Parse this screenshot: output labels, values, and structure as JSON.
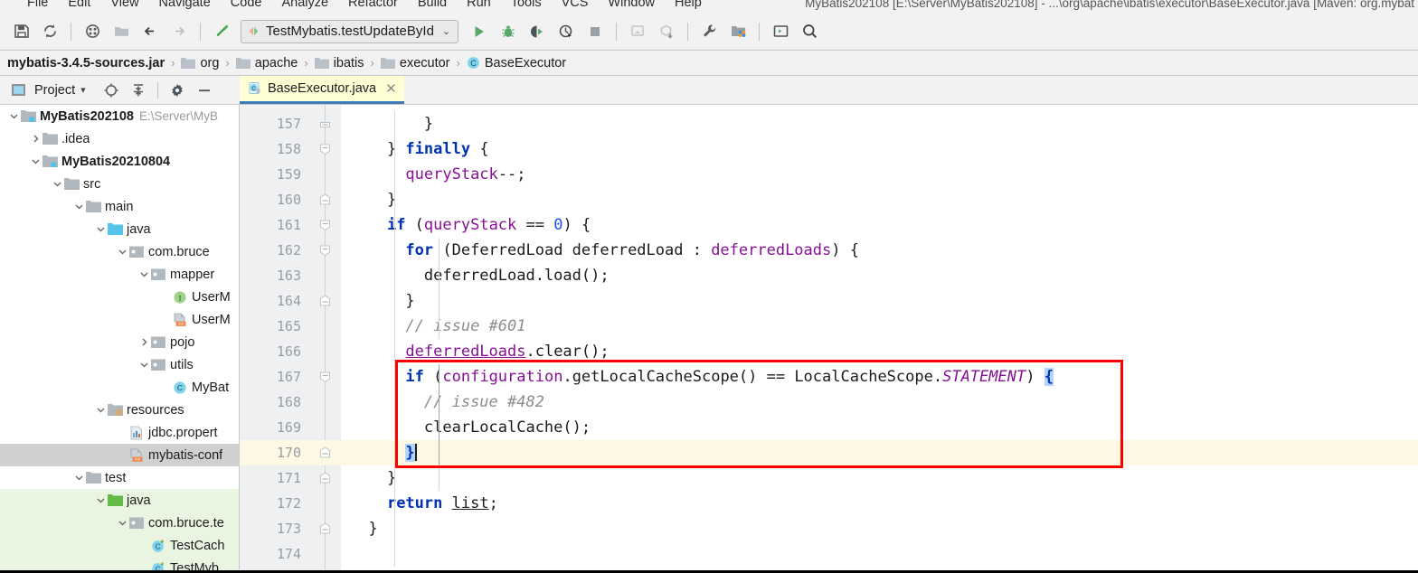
{
  "window": {
    "title": "MyBatis202108 [E:\\Server\\MyBatis202108] - ...\\org\\apache\\ibatis\\executor\\BaseExecutor.java [Maven: org.mybat"
  },
  "menubar": {
    "items": [
      "File",
      "Edit",
      "View",
      "Navigate",
      "Code",
      "Analyze",
      "Refactor",
      "Build",
      "Run",
      "Tools",
      "VCS",
      "Window",
      "Help"
    ]
  },
  "toolbar": {
    "icons_left": [
      "save-all-icon",
      "sync-icon",
      "settings-sync-icon",
      "open-folder-icon",
      "back-arrow-icon",
      "forward-arrow-icon",
      "build-hammer-icon"
    ],
    "run_config": {
      "label": "TestMybatis.testUpdateById",
      "chevron": "⌄"
    },
    "icons_right": [
      "run-icon",
      "debug-icon",
      "run-with-coverage-icon",
      "profile-icon",
      "stop-icon",
      "update-app-icon",
      "get-dependencies-icon",
      "wrench-icon",
      "project-structure-icon",
      "terminal-icon",
      "search-everywhere-icon"
    ]
  },
  "breadcrumb": {
    "root": "mybatis-3.4.5-sources.jar",
    "separator": "›",
    "segments": [
      {
        "label": "org",
        "icon": "folder-icon"
      },
      {
        "label": "apache",
        "icon": "folder-icon"
      },
      {
        "label": "ibatis",
        "icon": "folder-icon"
      },
      {
        "label": "executor",
        "icon": "folder-icon"
      },
      {
        "label": "BaseExecutor",
        "icon": "class-icon"
      }
    ]
  },
  "project_panel": {
    "title": "Project",
    "dropdown_chevron": "▾",
    "icons": [
      "locate-icon",
      "collapse-all-icon",
      "gear-icon",
      "hide-icon"
    ]
  },
  "editor_tab": {
    "label": "BaseExecutor.java",
    "icon": "java-class-file-icon",
    "close": "✕"
  },
  "tree": {
    "items": [
      {
        "label": "MyBatis202108",
        "path": "E:\\Server\\MyB",
        "depth": 0,
        "twist": "down",
        "icon": "module-folder-icon",
        "bold": true,
        "state": "normal"
      },
      {
        "label": ".idea",
        "path": "",
        "depth": 1,
        "twist": "right",
        "icon": "folder-icon",
        "bold": false,
        "state": "normal"
      },
      {
        "label": "MyBatis20210804",
        "path": "",
        "depth": 1,
        "twist": "down",
        "icon": "module-folder-icon",
        "bold": true,
        "state": "normal"
      },
      {
        "label": "src",
        "path": "",
        "depth": 2,
        "twist": "down",
        "icon": "folder-icon",
        "bold": false,
        "state": "normal"
      },
      {
        "label": "main",
        "path": "",
        "depth": 3,
        "twist": "down",
        "icon": "folder-icon",
        "bold": false,
        "state": "normal"
      },
      {
        "label": "java",
        "path": "",
        "depth": 4,
        "twist": "down",
        "icon": "source-root-icon",
        "bold": false,
        "state": "normal"
      },
      {
        "label": "com.bruce",
        "path": "",
        "depth": 5,
        "twist": "down",
        "icon": "package-icon",
        "bold": false,
        "state": "normal"
      },
      {
        "label": "mapper",
        "path": "",
        "depth": 6,
        "twist": "down",
        "icon": "package-icon",
        "bold": false,
        "state": "normal"
      },
      {
        "label": "UserM",
        "path": "",
        "depth": 7,
        "twist": "none",
        "icon": "interface-icon",
        "bold": false,
        "state": "normal"
      },
      {
        "label": "UserM",
        "path": "",
        "depth": 7,
        "twist": "none",
        "icon": "xml-file-icon",
        "bold": false,
        "state": "normal"
      },
      {
        "label": "pojo",
        "path": "",
        "depth": 6,
        "twist": "right",
        "icon": "package-icon",
        "bold": false,
        "state": "normal"
      },
      {
        "label": "utils",
        "path": "",
        "depth": 6,
        "twist": "down",
        "icon": "package-icon",
        "bold": false,
        "state": "normal"
      },
      {
        "label": "MyBat",
        "path": "",
        "depth": 7,
        "twist": "none",
        "icon": "class-icon",
        "bold": false,
        "state": "normal"
      },
      {
        "label": "resources",
        "path": "",
        "depth": 4,
        "twist": "down",
        "icon": "resource-root-icon",
        "bold": false,
        "state": "normal"
      },
      {
        "label": "jdbc.propert",
        "path": "",
        "depth": 5,
        "twist": "none",
        "icon": "properties-file-icon",
        "bold": false,
        "state": "normal"
      },
      {
        "label": "mybatis-conf",
        "path": "",
        "depth": 5,
        "twist": "none",
        "icon": "xml-file-icon",
        "bold": false,
        "state": "selected"
      },
      {
        "label": "test",
        "path": "",
        "depth": 3,
        "twist": "down",
        "icon": "folder-icon",
        "bold": false,
        "state": "normal"
      },
      {
        "label": "java",
        "path": "",
        "depth": 4,
        "twist": "down",
        "icon": "test-source-root-icon",
        "bold": false,
        "state": "green"
      },
      {
        "label": "com.bruce.te",
        "path": "",
        "depth": 5,
        "twist": "down",
        "icon": "package-icon",
        "bold": false,
        "state": "green"
      },
      {
        "label": "TestCach",
        "path": "",
        "depth": 6,
        "twist": "none",
        "icon": "test-class-icon",
        "bold": false,
        "state": "green"
      },
      {
        "label": "TestMyb",
        "path": "",
        "depth": 6,
        "twist": "none",
        "icon": "test-class-icon",
        "bold": false,
        "state": "green"
      }
    ]
  },
  "editor": {
    "first_line_number": 157,
    "lines": [
      {
        "n": 157,
        "fold": "collapse-top",
        "indent_guides": [],
        "highlight": false,
        "tokens": [
          {
            "t": "        }",
            "c": "pl"
          }
        ]
      },
      {
        "n": 158,
        "fold": "collapse-mid",
        "indent_guides": [],
        "highlight": false,
        "tokens": [
          {
            "t": "    } ",
            "c": "pl"
          },
          {
            "t": "finally",
            "c": "k"
          },
          {
            "t": " {",
            "c": "pl"
          }
        ]
      },
      {
        "n": 159,
        "fold": "none",
        "indent_guides": [],
        "highlight": false,
        "tokens": [
          {
            "t": "      ",
            "c": "pl"
          },
          {
            "t": "queryStack",
            "c": "fld"
          },
          {
            "t": "--;",
            "c": "pl"
          }
        ]
      },
      {
        "n": 160,
        "fold": "collapse-end",
        "indent_guides": [],
        "highlight": false,
        "tokens": [
          {
            "t": "    }",
            "c": "pl"
          }
        ]
      },
      {
        "n": 161,
        "fold": "collapse-mid",
        "indent_guides": [],
        "highlight": false,
        "tokens": [
          {
            "t": "    ",
            "c": "pl"
          },
          {
            "t": "if",
            "c": "k"
          },
          {
            "t": " (",
            "c": "pl"
          },
          {
            "t": "queryStack",
            "c": "fld"
          },
          {
            "t": " == ",
            "c": "pl"
          },
          {
            "t": "0",
            "c": "num"
          },
          {
            "t": ") {",
            "c": "pl"
          }
        ]
      },
      {
        "n": 162,
        "fold": "collapse-mid",
        "indent_guides": [],
        "highlight": false,
        "tokens": [
          {
            "t": "      ",
            "c": "pl"
          },
          {
            "t": "for",
            "c": "k"
          },
          {
            "t": " (DeferredLoad deferredLoad : ",
            "c": "pl"
          },
          {
            "t": "deferredLoads",
            "c": "fld"
          },
          {
            "t": ") {",
            "c": "pl"
          }
        ]
      },
      {
        "n": 163,
        "fold": "none",
        "indent_guides": [],
        "highlight": false,
        "tokens": [
          {
            "t": "        deferredLoad.load();",
            "c": "pl"
          }
        ]
      },
      {
        "n": 164,
        "fold": "collapse-end",
        "indent_guides": [],
        "highlight": false,
        "tokens": [
          {
            "t": "      }",
            "c": "pl"
          }
        ]
      },
      {
        "n": 165,
        "fold": "none",
        "indent_guides": [],
        "highlight": false,
        "tokens": [
          {
            "t": "      ",
            "c": "pl"
          },
          {
            "t": "// issue #601",
            "c": "cmt"
          }
        ]
      },
      {
        "n": 166,
        "fold": "none",
        "indent_guides": [],
        "highlight": false,
        "tokens": [
          {
            "t": "      ",
            "c": "pl"
          },
          {
            "t": "deferredLoads",
            "c": "fld und"
          },
          {
            "t": ".clear();",
            "c": "pl"
          }
        ]
      },
      {
        "n": 167,
        "fold": "collapse-mid",
        "indent_guides": [],
        "highlight": false,
        "tokens": [
          {
            "t": "      ",
            "c": "pl"
          },
          {
            "t": "if",
            "c": "k"
          },
          {
            "t": " (",
            "c": "pl"
          },
          {
            "t": "configuration",
            "c": "fld"
          },
          {
            "t": ".getLocalCacheScope() == LocalCacheScope.",
            "c": "pl"
          },
          {
            "t": "STATEMENT",
            "c": "sta"
          },
          {
            "t": ") ",
            "c": "pl"
          },
          {
            "t": "{",
            "c": "k selbr"
          }
        ]
      },
      {
        "n": 168,
        "fold": "none",
        "indent_guides": [],
        "highlight": false,
        "tokens": [
          {
            "t": "        ",
            "c": "pl"
          },
          {
            "t": "// issue #482",
            "c": "cmt"
          }
        ]
      },
      {
        "n": 169,
        "fold": "none",
        "indent_guides": [],
        "highlight": false,
        "tokens": [
          {
            "t": "        clearLocalCache();",
            "c": "pl"
          }
        ]
      },
      {
        "n": 170,
        "fold": "collapse-end",
        "indent_guides": [],
        "highlight": true,
        "tokens": [
          {
            "t": "      ",
            "c": "pl"
          },
          {
            "t": "}",
            "c": "k selbr"
          }
        ],
        "caret": true
      },
      {
        "n": 171,
        "fold": "collapse-end",
        "indent_guides": [],
        "highlight": false,
        "tokens": [
          {
            "t": "    }",
            "c": "pl"
          }
        ]
      },
      {
        "n": 172,
        "fold": "none",
        "indent_guides": [],
        "highlight": false,
        "tokens": [
          {
            "t": "    ",
            "c": "pl"
          },
          {
            "t": "return",
            "c": "k"
          },
          {
            "t": " ",
            "c": "pl"
          },
          {
            "t": "list",
            "c": "pl und"
          },
          {
            "t": ";",
            "c": "pl"
          }
        ]
      },
      {
        "n": 173,
        "fold": "collapse-end",
        "indent_guides": [],
        "highlight": false,
        "tokens": [
          {
            "t": "  }",
            "c": "pl"
          }
        ]
      },
      {
        "n": 174,
        "fold": "none",
        "indent_guides": [],
        "highlight": false,
        "tokens": [
          {
            "t": "",
            "c": "pl"
          }
        ]
      }
    ],
    "annotation": {
      "type": "red-rectangle",
      "color": "#ff0000",
      "covers_lines": [
        167,
        170
      ]
    }
  }
}
